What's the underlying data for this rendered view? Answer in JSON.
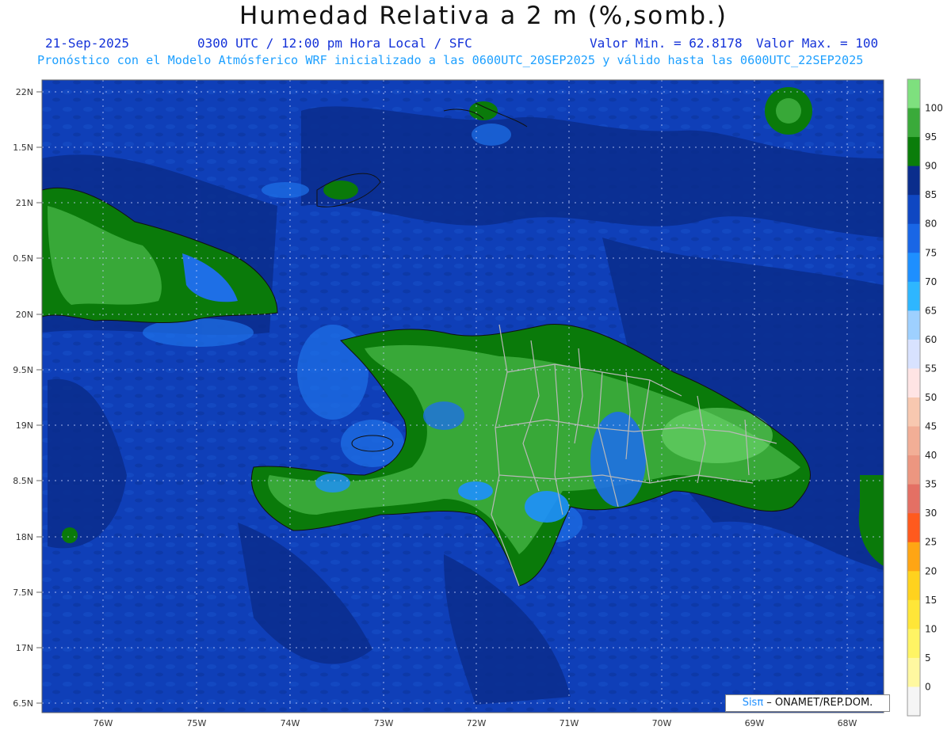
{
  "header": {
    "title": "Humedad Relativa a 2 m (%,somb.)",
    "date": "21-Sep-2025",
    "time": "0300 UTC / 12:00 pm Hora Local / SFC",
    "min_value": "Valor Min. = 62.8178",
    "max_value": "Valor Max. = 100",
    "model_line": "Pronóstico con el Modelo Atmósferico WRF inicializado a las 0600UTC_20SEP2025 y válido hasta las  0600UTC_22SEP2025"
  },
  "map": {
    "lat_labels": [
      "22N",
      "1.5N",
      "21N",
      "0.5N",
      "20N",
      "9.5N",
      "19N",
      "8.5N",
      "18N",
      "7.5N",
      "17N",
      "6.5N"
    ],
    "lon_labels": [
      "76W",
      "75W",
      "74W",
      "73W",
      "72W",
      "71W",
      "70W",
      "69W",
      "68W"
    ],
    "ocean_color": "#0f3fb8",
    "land_colors": {
      "moist_90": "#0a7a0a",
      "moist_95": "#38a838",
      "moist_100": "#74dc74",
      "humid_85": "#0a2d8c",
      "humid_75": "#1e6fe6",
      "humid_70": "#1e8fff"
    }
  },
  "colorbar": {
    "labels": [
      "100",
      "95",
      "90",
      "85",
      "80",
      "75",
      "70",
      "65",
      "60",
      "55",
      "50",
      "45",
      "40",
      "35",
      "30",
      "25",
      "20",
      "15",
      "10",
      "5",
      "0"
    ],
    "colors": [
      "#7ee07e",
      "#3aaa3a",
      "#0a7d0a",
      "#0a2d8c",
      "#0f47c2",
      "#1966e6",
      "#1e8fff",
      "#2eb6ff",
      "#9ed0ff",
      "#d8e2ff",
      "#ffe4e4",
      "#f8c8b0",
      "#f2ae96",
      "#ec9680",
      "#e47064",
      "#ff5a1e",
      "#ffa514",
      "#ffd21e",
      "#ffe638",
      "#fff464",
      "#fff8a0",
      "#f5f5f5"
    ]
  },
  "credit": {
    "brand": "Sisπ",
    "text": " – ONAMET/REP.DOM."
  }
}
